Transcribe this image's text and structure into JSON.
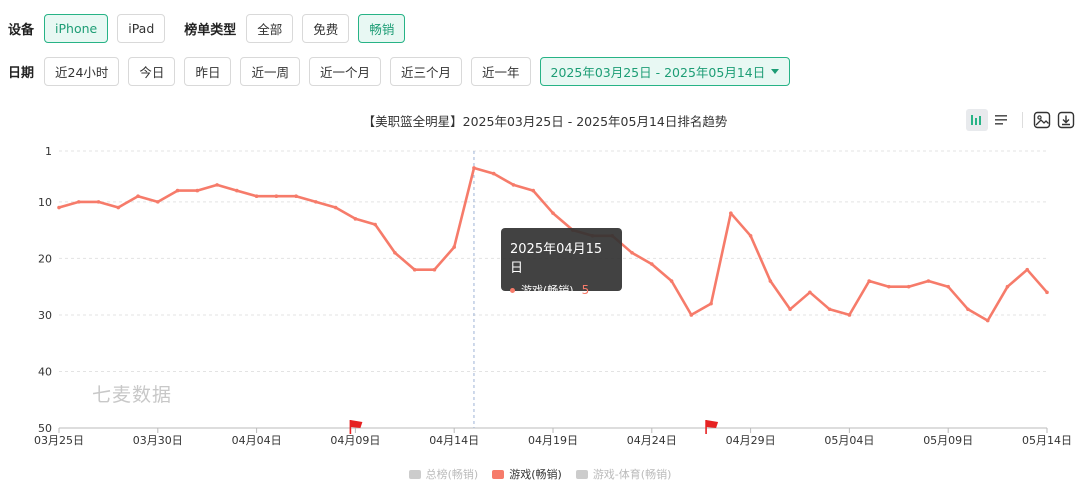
{
  "filters": {
    "device_label": "设备",
    "device_options": [
      {
        "label": "iPhone",
        "active": true
      },
      {
        "label": "iPad",
        "active": false
      }
    ],
    "chart_type_label": "榜单类型",
    "chart_type_options": [
      {
        "label": "全部",
        "active": false
      },
      {
        "label": "免费",
        "active": false
      },
      {
        "label": "畅销",
        "active": true
      }
    ],
    "date_label": "日期",
    "date_options": [
      "近24小时",
      "今日",
      "昨日",
      "近一周",
      "近一个月",
      "近三个月",
      "近一年"
    ],
    "date_range": "2025年03月25日 - 2025年05月14日"
  },
  "toolbar": {
    "icons": [
      "bar-chart-icon",
      "list-icon",
      "image-icon",
      "download-icon"
    ]
  },
  "watermark": "七麦数据",
  "tooltip": {
    "date": "2025年04月15日",
    "series": "游戏(畅销)",
    "value": "5"
  },
  "legend": [
    {
      "name": "总榜(畅销)",
      "color": "#cccccc",
      "active": false
    },
    {
      "name": "游戏(畅销)",
      "color": "#f67b6a",
      "active": true
    },
    {
      "name": "游戏-体育(畅销)",
      "color": "#cccccc",
      "active": false
    }
  ],
  "colors": {
    "accent": "#1d9d75",
    "series": "#f67b6a",
    "grid": "#e3e3e3"
  },
  "chart_data": {
    "type": "line",
    "title": "【美职篮全明星】2025年03月25日 - 2025年05月14日排名趋势",
    "xlabel": "",
    "ylabel": "",
    "x_ticks": [
      "03月25日",
      "03月30日",
      "04月04日",
      "04月09日",
      "04月14日",
      "04月19日",
      "04月24日",
      "04月29日",
      "05月04日",
      "05月09日",
      "05月14日"
    ],
    "y_ticks": [
      1,
      10,
      20,
      30,
      40,
      50
    ],
    "ylim": [
      1,
      50
    ],
    "y_reversed": true,
    "grid": true,
    "legend_position": "bottom",
    "x": [
      "03-25",
      "03-26",
      "03-27",
      "03-28",
      "03-29",
      "03-30",
      "03-31",
      "04-01",
      "04-02",
      "04-03",
      "04-04",
      "04-05",
      "04-06",
      "04-07",
      "04-08",
      "04-09",
      "04-10",
      "04-11",
      "04-12",
      "04-13",
      "04-14",
      "04-15",
      "04-16",
      "04-17",
      "04-18",
      "04-19",
      "04-20",
      "04-21",
      "04-22",
      "04-23",
      "04-24",
      "04-25",
      "04-26",
      "04-27",
      "04-28",
      "04-29",
      "04-30",
      "05-01",
      "05-02",
      "05-03",
      "05-04",
      "05-05",
      "05-06",
      "05-07",
      "05-08",
      "05-09",
      "05-10",
      "05-11",
      "05-12",
      "05-13",
      "05-14"
    ],
    "series": [
      {
        "name": "游戏(畅销)",
        "values": [
          11,
          10,
          10,
          11,
          9,
          10,
          8,
          8,
          7,
          8,
          9,
          9,
          9,
          10,
          11,
          13,
          14,
          19,
          22,
          22,
          18,
          4,
          5,
          7,
          8,
          12,
          15,
          16,
          16,
          19,
          21,
          24,
          30,
          28,
          12,
          16,
          24,
          29,
          26,
          29,
          30,
          24,
          25,
          25,
          24,
          25,
          29,
          31,
          25,
          22,
          26
        ]
      }
    ],
    "flags_at": [
      "04-09",
      "04-27"
    ]
  }
}
